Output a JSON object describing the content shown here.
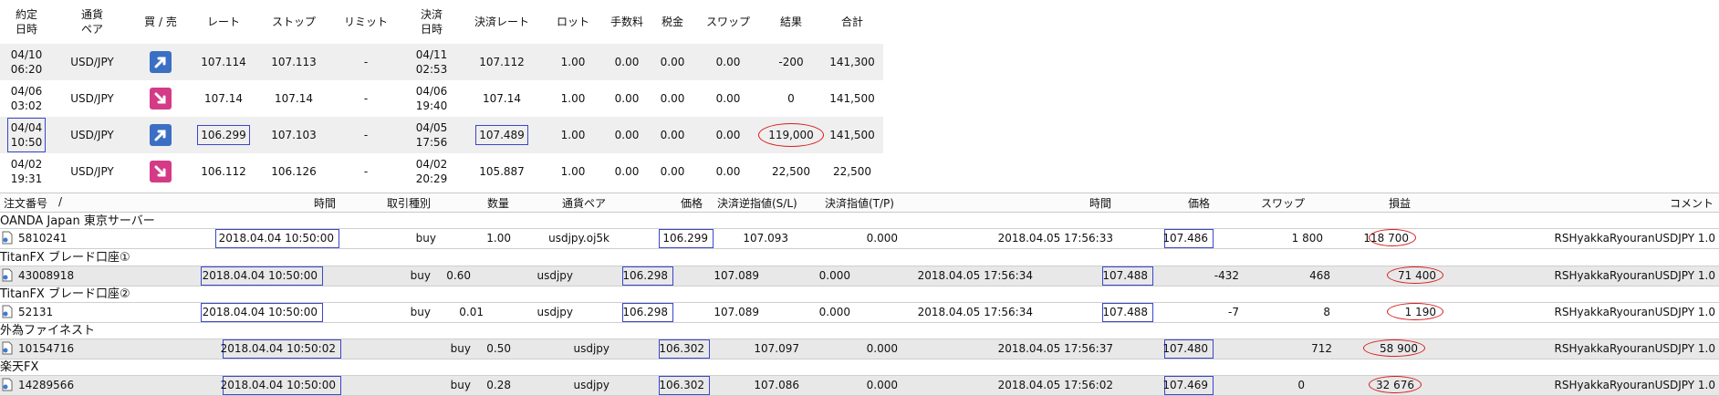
{
  "top_table": {
    "headers": [
      [
        "約定",
        "日時"
      ],
      [
        "通貨",
        "ペア"
      ],
      [
        "買 / 売"
      ],
      [
        "レート"
      ],
      [
        "ストップ"
      ],
      [
        "リミット"
      ],
      [
        "決済",
        "日時"
      ],
      [
        "決済レート"
      ],
      [
        "ロット"
      ],
      [
        "手数料"
      ],
      [
        "税金"
      ],
      [
        "スワップ"
      ],
      [
        "結果"
      ],
      [
        "合計"
      ]
    ],
    "rows": [
      {
        "date1": "04/10",
        "date2": "06:20",
        "pair": "USD/JPY",
        "dir": "buy",
        "rate": "107.114",
        "stop": "107.113",
        "limit": "-",
        "cdate1": "04/11",
        "cdate2": "02:53",
        "crate": "107.112",
        "lot": "1.00",
        "fee": "0.00",
        "tax": "0.00",
        "swap": "0.00",
        "result": "-200",
        "total": "141,300"
      },
      {
        "date1": "04/06",
        "date2": "03:02",
        "pair": "USD/JPY",
        "dir": "sell",
        "rate": "107.14",
        "stop": "107.14",
        "limit": "-",
        "cdate1": "04/06",
        "cdate2": "19:40",
        "crate": "107.14",
        "lot": "1.00",
        "fee": "0.00",
        "tax": "0.00",
        "swap": "0.00",
        "result": "0",
        "total": "141,500"
      },
      {
        "date1": "04/04",
        "date2": "10:50",
        "pair": "USD/JPY",
        "dir": "buy",
        "rate": "106.299",
        "stop": "107.103",
        "limit": "-",
        "cdate1": "04/05",
        "cdate2": "17:56",
        "crate": "107.489",
        "lot": "1.00",
        "fee": "0.00",
        "tax": "0.00",
        "swap": "0.00",
        "result": "119,000",
        "total": "141,500"
      },
      {
        "date1": "04/02",
        "date2": "19:31",
        "pair": "USD/JPY",
        "dir": "sell",
        "rate": "106.112",
        "stop": "106.126",
        "limit": "-",
        "cdate1": "04/02",
        "cdate2": "20:29",
        "crate": "105.887",
        "lot": "1.00",
        "fee": "0.00",
        "tax": "0.00",
        "swap": "0.00",
        "result": "22,500",
        "total": "22,500"
      }
    ]
  },
  "order_table": {
    "headers": {
      "order_no": "注文番号",
      "sort": "/",
      "time": "時間",
      "type": "取引種別",
      "qty": "数量",
      "pair": "通貨ペア",
      "price": "価格",
      "sl": "決済逆指値(S/L)",
      "tp": "決済指値(T/P)",
      "close_time": "時間",
      "close_price": "価格",
      "swap": "スワップ",
      "pnl": "損益",
      "comment": "コメント"
    },
    "groups": [
      {
        "name": "OANDA Japan 東京サーバー",
        "order": "5810241",
        "time": "2018.04.04 10:50:00",
        "type": "buy",
        "qty": "1.00",
        "pair": "usdjpy.oj5k",
        "price": "106.299",
        "sl": "107.093",
        "tp": "0.000",
        "close_time": "2018.04.05 17:56:33",
        "close_price": "107.486",
        "extra": "",
        "swap": "1 800",
        "pnl": "118 700",
        "comment": "RSHyakkaRyouranUSDJPY 1.0"
      },
      {
        "name": "TitanFX ブレード口座①",
        "order": "43008918",
        "time": "2018.04.04 10:50:00",
        "type": "buy",
        "qty": "0.60",
        "pair": "usdjpy",
        "price": "106.298",
        "sl": "107.089",
        "tp": "0.000",
        "close_time": "2018.04.05 17:56:34",
        "close_price": "107.488",
        "extra": "-432",
        "swap": "468",
        "pnl": "71 400",
        "comment": "RSHyakkaRyouranUSDJPY 1.0"
      },
      {
        "name": "TitanFX ブレード口座②",
        "order": "52131",
        "time": "2018.04.04 10:50:00",
        "type": "buy",
        "qty": "0.01",
        "pair": "usdjpy",
        "price": "106.298",
        "sl": "107.089",
        "tp": "0.000",
        "close_time": "2018.04.05 17:56:34",
        "close_price": "107.488",
        "extra": "-7",
        "swap": "8",
        "pnl": "1 190",
        "comment": "RSHyakkaRyouranUSDJPY 1.0"
      },
      {
        "name": "外為ファイネスト",
        "order": "10154716",
        "time": "2018.04.04 10:50:02",
        "type": "buy",
        "qty": "0.50",
        "pair": "usdjpy",
        "price": "106.302",
        "sl": "107.097",
        "tp": "0.000",
        "close_time": "2018.04.05 17:56:37",
        "close_price": "107.480",
        "extra": "",
        "swap": "712",
        "pnl": "58 900",
        "comment": "RSHyakkaRyouranUSDJPY 1.0"
      },
      {
        "name": "楽天FX",
        "order": "14289566",
        "time": "2018.04.04 10:50:00",
        "type": "buy",
        "qty": "0.28",
        "pair": "usdjpy",
        "price": "106.302",
        "sl": "107.086",
        "tp": "0.000",
        "close_time": "2018.04.05 17:56:02",
        "close_price": "107.469",
        "extra": "",
        "swap": "0",
        "pnl": "32 676",
        "comment": "RSHyakkaRyouranUSDJPY 1.0"
      }
    ]
  },
  "colors": {
    "buy_icon": "#3b6fc4",
    "sell_icon": "#d43a86",
    "highlight_box": "#3a46c8",
    "highlight_oval": "#d81c1c"
  }
}
